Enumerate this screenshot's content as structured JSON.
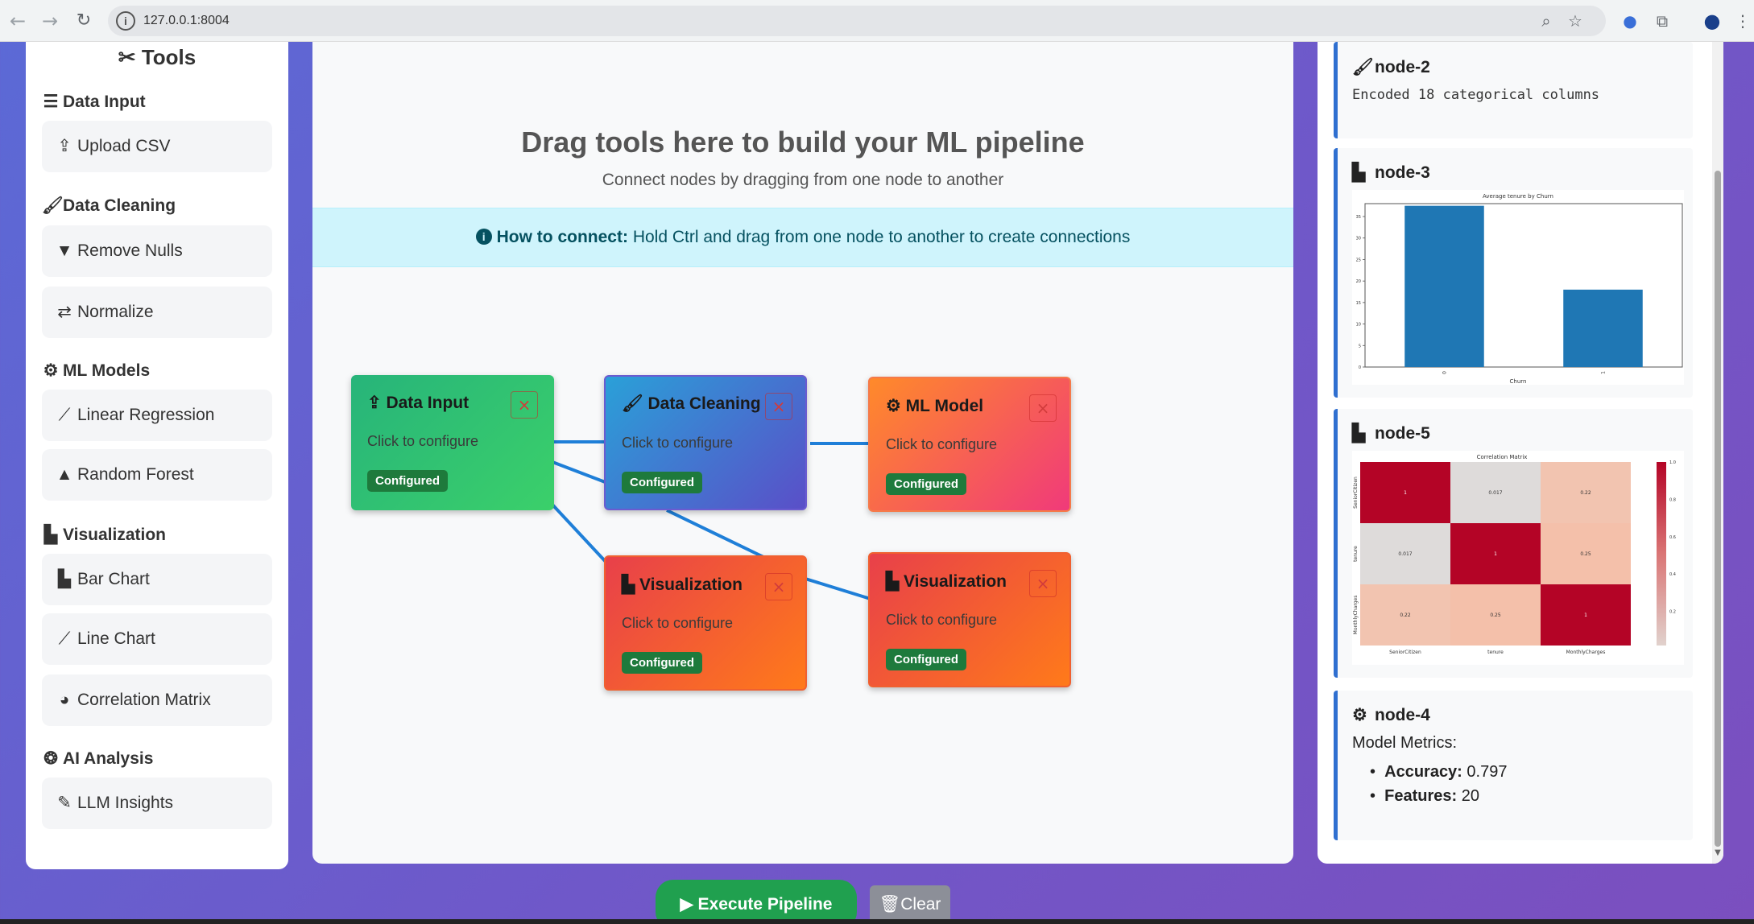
{
  "browser": {
    "url": "127.0.0.1:8004",
    "icons": [
      "back-icon",
      "forward-icon",
      "reload-icon",
      "info-icon",
      "zoom-icon",
      "star-icon",
      "extension-icon",
      "puzzle-icon",
      "profile-icon",
      "menu-icon"
    ]
  },
  "sidebar": {
    "title": "Tools",
    "categories": [
      {
        "label": "Data Input",
        "icon": "database-icon",
        "tools": [
          {
            "label": "Upload CSV",
            "icon": "upload-icon"
          }
        ]
      },
      {
        "label": "Data Cleaning",
        "icon": "broom-icon",
        "tools": [
          {
            "label": "Remove Nulls",
            "icon": "filter-icon"
          },
          {
            "label": "Normalize",
            "icon": "exchange-icon"
          }
        ]
      },
      {
        "label": "ML Models",
        "icon": "robot-icon",
        "tools": [
          {
            "label": "Linear Regression",
            "icon": "line-chart-icon"
          },
          {
            "label": "Random Forest",
            "icon": "tree-icon"
          }
        ]
      },
      {
        "label": "Visualization",
        "icon": "bar-chart-icon",
        "tools": [
          {
            "label": "Bar Chart",
            "icon": "bar-chart-icon"
          },
          {
            "label": "Line Chart",
            "icon": "line-chart-icon"
          },
          {
            "label": "Correlation Matrix",
            "icon": "pie-chart-icon"
          }
        ]
      },
      {
        "label": "AI Analysis",
        "icon": "brain-icon",
        "tools": [
          {
            "label": "LLM Insights",
            "icon": "pen-icon"
          }
        ]
      }
    ]
  },
  "canvas": {
    "title": "Drag tools here to build your ML pipeline",
    "subtitle": "Connect nodes by dragging from one node to another",
    "howto_label": "How to connect:",
    "howto_text": "Hold Ctrl and drag from one node to another to create connections",
    "nodes": [
      {
        "title": "Data Input",
        "icon": "upload-icon",
        "subtitle": "Click to configure",
        "badge": "Configured",
        "close": "×"
      },
      {
        "title": "Data Cleaning",
        "icon": "broom-icon",
        "subtitle": "Click to configure",
        "badge": "Configured",
        "close": "×"
      },
      {
        "title": "ML Model",
        "icon": "robot-icon",
        "subtitle": "Click to configure",
        "badge": "Configured",
        "close": "×"
      },
      {
        "title": "Visualization",
        "icon": "bar-chart-icon",
        "subtitle": "Click to configure",
        "badge": "Configured",
        "close": "×"
      },
      {
        "title": "Visualization",
        "icon": "bar-chart-icon",
        "subtitle": "Click to configure",
        "badge": "Configured",
        "close": "×"
      }
    ]
  },
  "results": {
    "node2": {
      "title": "node-2",
      "icon": "broom-icon",
      "text": "Encoded 18 categorical columns"
    },
    "node3": {
      "title": "node-3",
      "icon": "bar-chart-icon"
    },
    "node5": {
      "title": "node-5",
      "icon": "bar-chart-icon"
    },
    "node4": {
      "title": "node-4",
      "icon": "robot-icon",
      "metrics_label": "Model Metrics:",
      "accuracy_label": "Accuracy:",
      "accuracy_value": "0.797",
      "features_label": "Features:",
      "features_value": "20"
    }
  },
  "chart_data": [
    {
      "type": "bar",
      "title": "Average tenure by Churn",
      "xlabel": "Churn",
      "ylabel": "",
      "categories": [
        "0",
        "1"
      ],
      "values": [
        37.5,
        18
      ],
      "ylim": [
        0,
        38
      ],
      "yticks": [
        0,
        5,
        10,
        15,
        20,
        25,
        30,
        35
      ],
      "color": "#1f77b4"
    },
    {
      "type": "heatmap",
      "title": "Correlation Matrix",
      "labels": [
        "SeniorCitizen",
        "tenure",
        "MonthlyCharges"
      ],
      "values": [
        [
          1,
          0.017,
          0.22
        ],
        [
          0.017,
          1,
          0.25
        ],
        [
          0.22,
          0.25,
          1
        ]
      ],
      "colorbar_ticks": [
        0.2,
        0.4,
        0.6,
        0.8,
        1.0
      ],
      "colormap": "coolwarm"
    }
  ],
  "footer": {
    "execute_label": "Execute Pipeline",
    "clear_label": "Clear"
  }
}
